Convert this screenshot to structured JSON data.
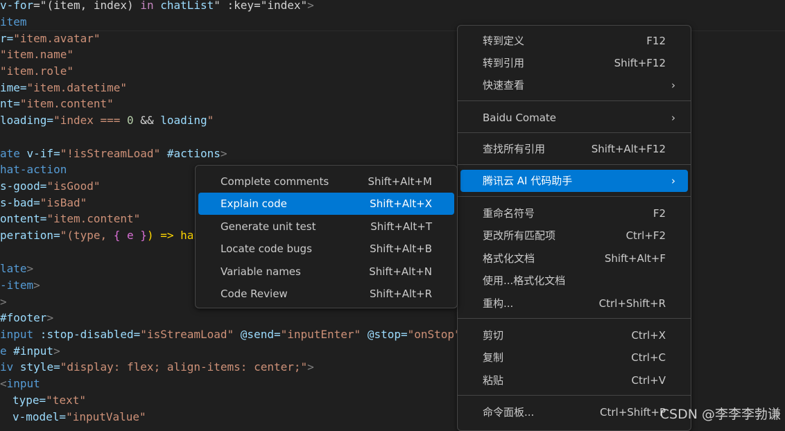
{
  "code": {
    "l1": [
      "v-for",
      "=\"",
      "(item, index)",
      " in ",
      "chatList",
      "\" :key=",
      "\"index\"",
      ">"
    ],
    "l2": "item",
    "l3": [
      "r=",
      "\"item.avatar\""
    ],
    "l4": [
      "\"item.name\""
    ],
    "l5": [
      "\"item.role\""
    ],
    "l6": [
      "ime=",
      "\"item.datetime\""
    ],
    "l7": [
      "nt=",
      "\"item.content\""
    ],
    "l8": [
      "loading=",
      "\"index === ",
      "0",
      " && ",
      "loading",
      "\""
    ],
    "l9": [
      "ate ",
      "v-if=",
      "\"!isStreamLoad\"",
      " #actions",
      ">"
    ],
    "l10": "hat-action",
    "l11": [
      "s-good=",
      "\"isGood\""
    ],
    "l12": [
      "s-bad=",
      "\"isBad\""
    ],
    "l13": [
      "ontent=",
      "\"item.content\""
    ],
    "l14": [
      "peration=",
      "\"(type, ",
      "{ e }",
      ") => han"
    ],
    "l15": [
      "late",
      ">"
    ],
    "l16": [
      "-item",
      ">"
    ],
    "l17": ">",
    "l18": [
      "#footer",
      ">"
    ],
    "l19": [
      "input",
      " :stop-disabled=",
      "\"isStreamLoad\"",
      " @send=",
      "\"inputEnter\"",
      " @stop=",
      "\"onStop\""
    ],
    "l20": [
      "e ",
      "#input",
      ">"
    ],
    "l21": [
      "iv ",
      "style=",
      "\"display: ",
      "flex",
      "; align-items: ",
      "center",
      ";\"",
      ">"
    ],
    "l22": [
      "<",
      "input"
    ],
    "l23": [
      "type=",
      "\"text\""
    ],
    "l24": [
      "v-model=",
      "\"inputValue\""
    ]
  },
  "context_menu": {
    "items": [
      {
        "label": "转到定义",
        "shortcut": "F12"
      },
      {
        "label": "转到引用",
        "shortcut": "Shift+F12"
      },
      {
        "label": "快速查看",
        "chevron": "›"
      },
      {
        "label": "Baidu Comate",
        "chevron": "›"
      },
      {
        "label": "查找所有引用",
        "shortcut": "Shift+Alt+F12"
      },
      {
        "label": "腾讯云 AI 代码助手",
        "chevron": "›"
      },
      {
        "label": "重命名符号",
        "shortcut": "F2"
      },
      {
        "label": "更改所有匹配项",
        "shortcut": "Ctrl+F2"
      },
      {
        "label": "格式化文档",
        "shortcut": "Shift+Alt+F"
      },
      {
        "label": "使用...格式化文档"
      },
      {
        "label": "重构...",
        "shortcut": "Ctrl+Shift+R"
      },
      {
        "label": "剪切",
        "shortcut": "Ctrl+X"
      },
      {
        "label": "复制",
        "shortcut": "Ctrl+C"
      },
      {
        "label": "粘贴",
        "shortcut": "Ctrl+V"
      },
      {
        "label": "命令面板...",
        "shortcut": "Ctrl+Shift+P"
      }
    ]
  },
  "submenu": {
    "items": [
      {
        "label": "Complete comments",
        "shortcut": "Shift+Alt+M"
      },
      {
        "label": "Explain code",
        "shortcut": "Shift+Alt+X"
      },
      {
        "label": "Generate unit test",
        "shortcut": "Shift+Alt+T"
      },
      {
        "label": "Locate code bugs",
        "shortcut": "Shift+Alt+B"
      },
      {
        "label": "Variable names",
        "shortcut": "Shift+Alt+N"
      },
      {
        "label": "Code Review",
        "shortcut": "Shift+Alt+R"
      }
    ]
  },
  "watermark": "CSDN @李李李勃谦",
  "colors": {
    "accent": "#0078d4",
    "menu_bg": "#1f1f1f",
    "editor_bg": "#1f1f1f"
  }
}
